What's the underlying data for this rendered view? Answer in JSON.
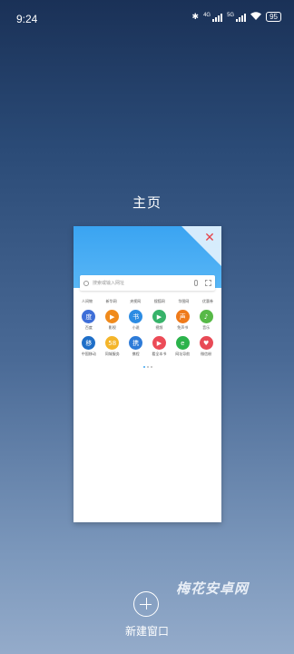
{
  "status": {
    "time": "9:24",
    "net1": "4G",
    "net2": "5G",
    "battery": "95"
  },
  "page_title": "主页",
  "card": {
    "search_placeholder": "搜索或输入网址",
    "tabs": [
      "人间物",
      "新华网",
      "央视网",
      "搜狐网",
      "华图网",
      "优惠券"
    ],
    "apps": [
      {
        "label": "百度",
        "color": "#3f6fd8",
        "glyph": "度"
      },
      {
        "label": "影视",
        "color": "#f08a1c",
        "glyph": "▶"
      },
      {
        "label": "小说",
        "color": "#2c8ce3",
        "glyph": "书"
      },
      {
        "label": "视频",
        "color": "#37b36a",
        "glyph": "▶"
      },
      {
        "label": "免声书",
        "color": "#ef7a1a",
        "glyph": "声"
      },
      {
        "label": "音乐",
        "color": "#57b947",
        "glyph": "♪"
      },
      {
        "label": "中国移动",
        "color": "#1f6fc8",
        "glyph": "移"
      },
      {
        "label": "同城服务",
        "color": "#f4b52a",
        "glyph": "58"
      },
      {
        "label": "携程",
        "color": "#2d7bd8",
        "glyph": "携"
      },
      {
        "label": "看全本书",
        "color": "#ec4b57",
        "glyph": "▶"
      },
      {
        "label": "网址导航",
        "color": "#2bb34b",
        "glyph": "e"
      },
      {
        "label": "微信粉",
        "color": "#e84a56",
        "glyph": "♥"
      }
    ]
  },
  "watermark": "梅花安卓网",
  "new_window_label": "新建窗口"
}
